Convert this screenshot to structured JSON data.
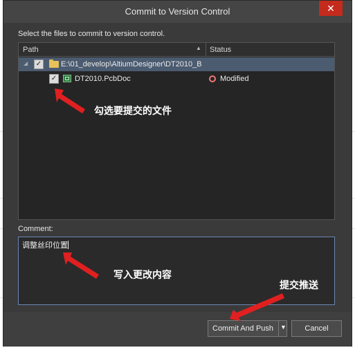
{
  "dialog": {
    "title": "Commit to Version Control",
    "close_glyph": "✕",
    "instruction": "Select the files to commit to version control."
  },
  "file_list": {
    "columns": {
      "path": "Path",
      "status": "Status"
    },
    "folder": {
      "path": "E:\\01_develop\\AltiumDesigner\\DT2010_B",
      "checked": true
    },
    "files": [
      {
        "name": "DT2010.PcbDoc",
        "checked": true,
        "status": "Modified",
        "status_color": "#f07878"
      }
    ]
  },
  "comment": {
    "label": "Comment:",
    "value": "调整丝印位置"
  },
  "buttons": {
    "commit_and_push": "Commit And Push",
    "cancel": "Cancel"
  },
  "annotations": {
    "select_files": "勾选要提交的文件",
    "write_comment": "写入更改内容",
    "commit_push": "提交推送",
    "color": "#e02020"
  }
}
